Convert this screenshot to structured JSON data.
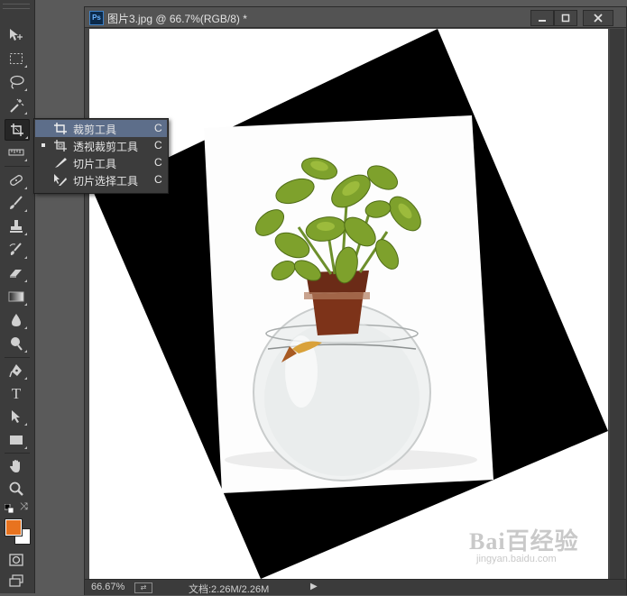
{
  "document": {
    "title": "图片3.jpg @ 66.7%(RGB/8) *",
    "app_icon": "Ps",
    "window_buttons": [
      "minimize-icon",
      "restore-icon",
      "close-icon"
    ]
  },
  "status": {
    "zoom": "66.67%",
    "doc_size": "文档:2.26M/2.26M",
    "arrow": "▶"
  },
  "flyout": {
    "items": [
      {
        "label": "裁剪工具",
        "shortcut": "C",
        "icon": "crop-icon",
        "selected": true
      },
      {
        "label": "透视裁剪工具",
        "shortcut": "C",
        "icon": "perspective-crop-icon",
        "selected": false,
        "current": true
      },
      {
        "label": "切片工具",
        "shortcut": "C",
        "icon": "slice-icon",
        "selected": false
      },
      {
        "label": "切片选择工具",
        "shortcut": "C",
        "icon": "slice-select-icon",
        "selected": false
      }
    ]
  },
  "toolbar": {
    "tools": [
      "move-tool",
      "marquee-tool",
      "lasso-tool",
      "magic-wand-tool",
      "crop-tool",
      "ruler-tool",
      "healing-tool",
      "brush-tool",
      "stamp-tool",
      "history-brush-tool",
      "eraser-tool",
      "gradient-tool",
      "blur-tool",
      "dodge-tool",
      "pen-tool",
      "type-tool",
      "path-select-tool",
      "rectangle-tool",
      "hand-tool",
      "zoom-tool"
    ],
    "type_glyph": "T",
    "foreground_color": "#e8731f",
    "background_color": "#ffffff"
  },
  "watermark": {
    "main": "Bai百经验",
    "sub": "jingyan.baidu.com"
  }
}
